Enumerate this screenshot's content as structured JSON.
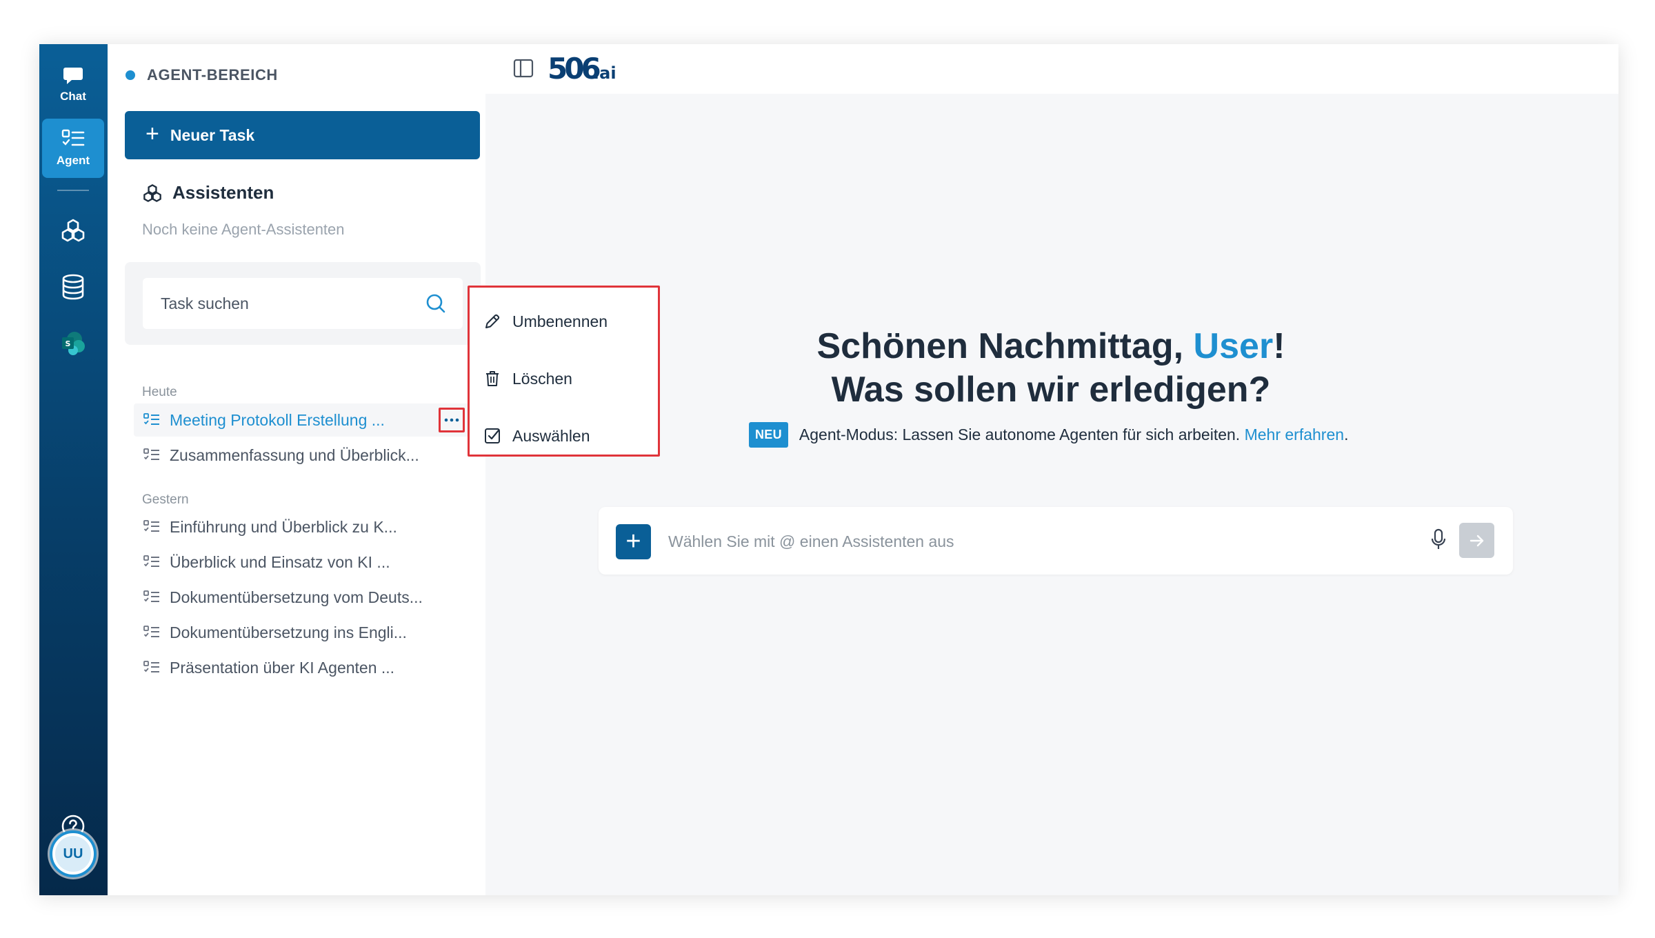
{
  "rail": {
    "chat_label": "Chat",
    "agent_label": "Agent",
    "avatar_initials": "UU"
  },
  "sidebar": {
    "area_title": "AGENT-BEREICH",
    "new_task_label": "Neuer Task",
    "assistants_title": "Assistenten",
    "assistants_empty": "Noch keine Agent-Assistenten",
    "search_placeholder": "Task suchen",
    "groups": [
      {
        "label": "Heute",
        "tasks": [
          "Meeting Protokoll Erstellung ...",
          "Zusammenfassung und Überblick..."
        ]
      },
      {
        "label": "Gestern",
        "tasks": [
          "Einführung und Überblick zu K...",
          "Überblick und Einsatz von KI ...",
          "Dokumentübersetzung vom Deuts...",
          "Dokumentübersetzung ins Engli...",
          "Präsentation über KI Agenten ..."
        ]
      }
    ]
  },
  "header": {
    "logo_text": "506",
    "logo_suffix": ".ai"
  },
  "main": {
    "greeting_prefix": "Schönen Nachmittag, ",
    "greeting_user": "User",
    "greeting_suffix": "!",
    "greeting_line2": "Was sollen wir erledigen?",
    "badge": "NEU",
    "info_text": "Agent-Modus: Lassen Sie autonome Agenten für sich arbeiten. ",
    "info_link": "Mehr erfahren",
    "info_end": ".",
    "chat_placeholder": "Wählen Sie mit @ einen Assistenten aus"
  },
  "context_menu": {
    "items": [
      "Umbenennen",
      "Löschen",
      "Auswählen"
    ]
  },
  "colors": {
    "accent": "#1e8fd0",
    "primary": "#0a5f97",
    "highlight_border": "#e0343a"
  }
}
